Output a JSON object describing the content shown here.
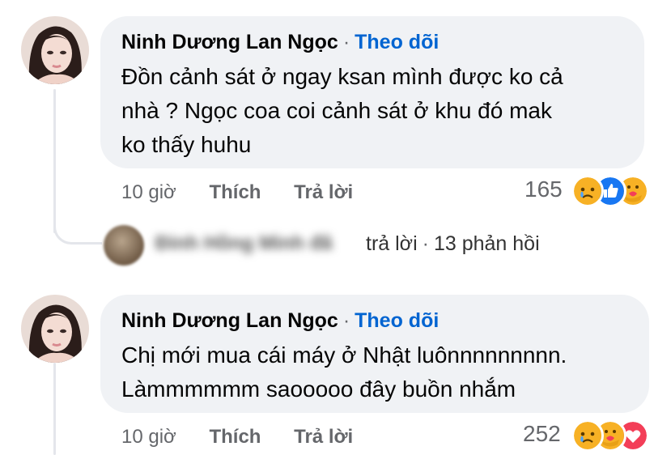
{
  "comments": [
    {
      "author": "Ninh Dương Lan Ngọc",
      "follow_label": "Theo dõi",
      "text_lines": [
        "Đồn cảnh sát ở ngay ksan mình được ko cả",
        "nhà ? Ngọc coa coi cảnh sát ở khu đó mak",
        "ko thấy huhu"
      ],
      "time": "10 giờ",
      "like_label": "Thích",
      "reply_label": "Trả lời",
      "reaction_count": "165",
      "reactions": [
        "sad-icon",
        "like-icon",
        "care-icon"
      ]
    },
    {
      "author": "Ninh Dương Lan Ngọc",
      "follow_label": "Theo dõi",
      "text_lines": [
        "Chị mới mua cái máy ở Nhật luônnnnnnnnn.",
        "Làmmmmmm saooooo đây buồn nhắm"
      ],
      "time": "10 giờ",
      "like_label": "Thích",
      "reply_label": "Trả lời",
      "reaction_count": "252",
      "reactions": [
        "sad-icon",
        "care-icon",
        "love-icon"
      ]
    }
  ],
  "replies_summary": {
    "blurred_name": "Đinh Hồng Minh đã",
    "replied_label": "trả lời",
    "separator": "·",
    "count_label": "13 phản hồi"
  },
  "colors": {
    "bubble": "#f0f2f5",
    "link": "#0064d1",
    "meta": "#65676b",
    "like": "#1877f2",
    "love": "#f33e58",
    "emoji": "#f7b125"
  }
}
